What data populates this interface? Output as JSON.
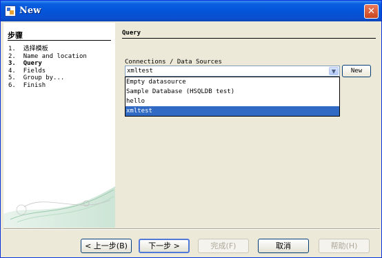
{
  "window": {
    "title": "New",
    "close_glyph": "✕"
  },
  "steps": {
    "heading": "步骤",
    "items": [
      {
        "num": "1.",
        "label": "选择模板"
      },
      {
        "num": "2.",
        "label": "Name and location"
      },
      {
        "num": "3.",
        "label": "Query",
        "current": true
      },
      {
        "num": "4.",
        "label": "Fields"
      },
      {
        "num": "5.",
        "label": "Group by..."
      },
      {
        "num": "6.",
        "label": "Finish"
      }
    ]
  },
  "page": {
    "title": "Query",
    "connections_label": "Connections / Data Sources",
    "combo_value": "xmltest",
    "new_button": "New",
    "options": [
      "Empty datasource",
      "Sample Database (HSQLDB test)",
      "hello",
      "xmltest"
    ],
    "selected_index": 3
  },
  "buttons": {
    "back": "< 上一步(B)",
    "next": "下一步 >",
    "finish": "完成(F)",
    "cancel": "取消",
    "help": "帮助(H)"
  },
  "icons": {
    "close": "close-icon",
    "app": "app-icon",
    "dropdown": "chevron-down-icon"
  }
}
